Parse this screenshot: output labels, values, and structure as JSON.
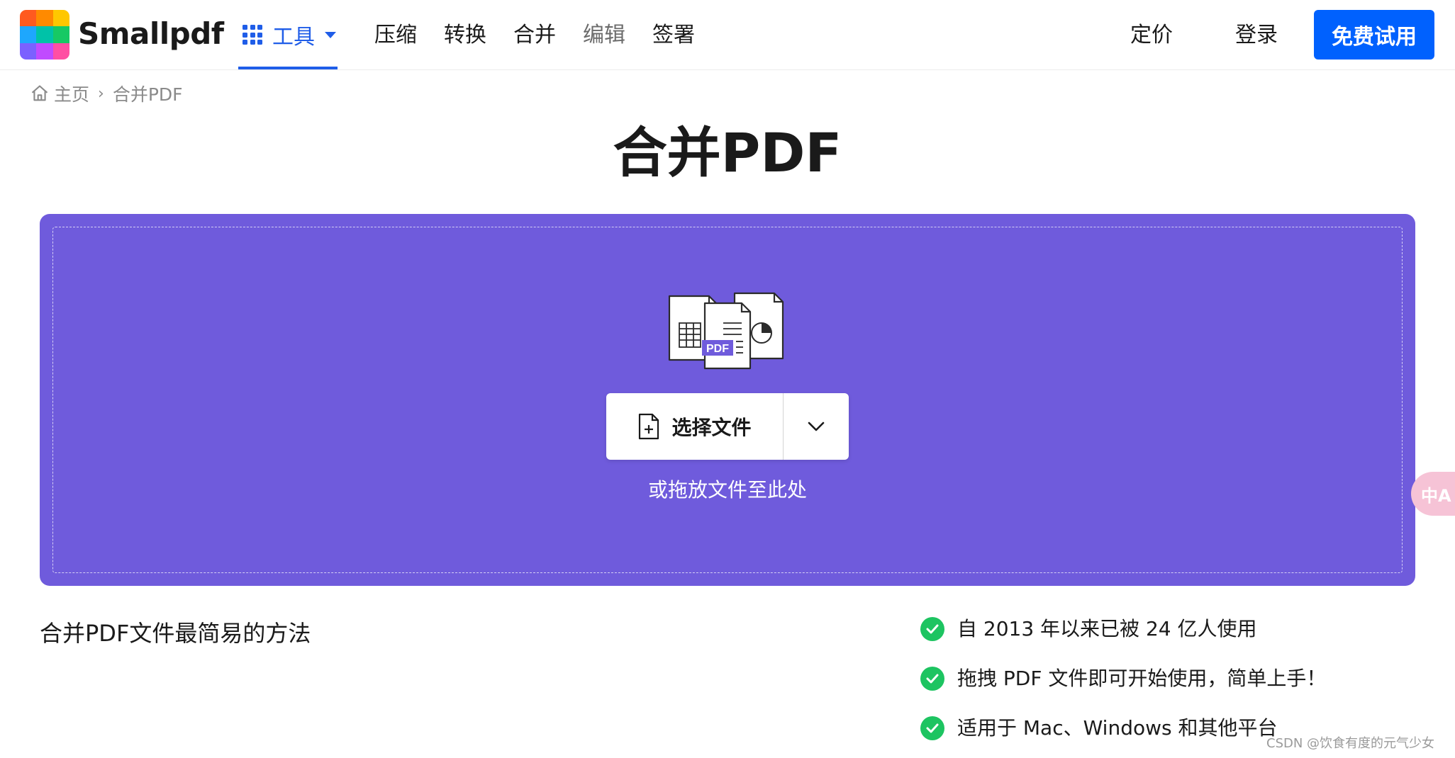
{
  "header": {
    "logo_text": "Smallpdf",
    "tools_label": "工具",
    "nav": [
      "压缩",
      "转换",
      "合并",
      "编辑",
      "签署"
    ],
    "pricing": "定价",
    "login": "登录",
    "trial_button": "免费试用"
  },
  "breadcrumb": {
    "home": "主页",
    "separator": "›",
    "current": "合并PDF"
  },
  "page_title": "合并PDF",
  "dropzone": {
    "files_icon_label": "PDF",
    "choose_button": "选择文件",
    "drop_hint": "或拖放文件至此处"
  },
  "side_widget": {
    "label": "中A"
  },
  "tagline": "合并PDF文件最简易的方法",
  "features": [
    "自 2013 年以来已被 24 亿人使用",
    "拖拽 PDF 文件即可开始使用，简单上手！",
    "适用于 Mac、Windows 和其他平台"
  ],
  "watermark": "CSDN @饮食有度的元气少女",
  "colors": {
    "brand_blue": "#0061fe",
    "link_blue": "#1f5de8",
    "dropzone_purple": "#6f5bdc",
    "check_green": "#1dc461"
  }
}
